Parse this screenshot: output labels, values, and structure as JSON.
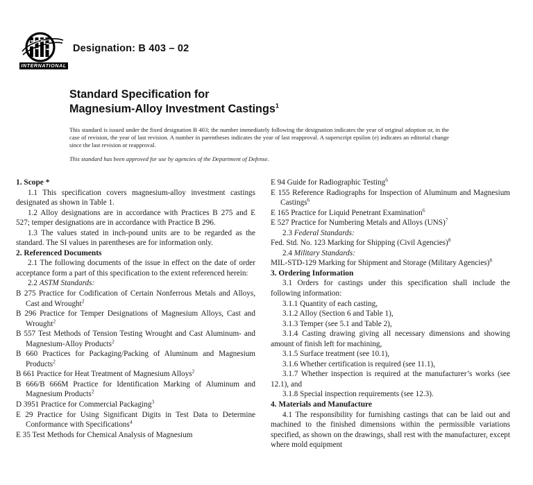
{
  "header": {
    "logo_name": "ASTM",
    "logo_subtitle": "INTERNATIONAL",
    "designation": "Designation: B 403 – 02"
  },
  "title": {
    "line1": "Standard Specification for",
    "line2": "Magnesium-Alloy Investment Castings",
    "footnote_marker": "1"
  },
  "disclaimer": {
    "text": "This standard is issued under the fixed designation B 403; the number immediately following the designation indicates the year of original adoption or, in the case of revision, the year of last revision. A number in parentheses indicates the year of last reapproval. A superscript epsilon (e) indicates an editorial change since the last revision or reapproval.",
    "dod_note": "This standard has been approved for use by agencies of the Department of Defense."
  },
  "left_column": {
    "section1_heading": "1. Scope *",
    "p_1_1": "1.1 This specification covers magnesium-alloy investment castings designated as shown in Table 1.",
    "p_1_2": "1.2 Alloy designations are in accordance with Practices B 275 and E 527; temper designations are in accordance with Practice B 296.",
    "p_1_3": "1.3 The values stated in inch-pound units are to be regarded as the standard. The SI values in parentheses are for information only.",
    "section2_heading": "2. Referenced Documents",
    "p_2_1": "2.1 The following documents of the issue in effect on the date of order acceptance form a part of this specification to the extent referenced herein:",
    "sub_2_2_num": "2.2 ",
    "sub_2_2": "ASTM Standards:",
    "refs": [
      {
        "text": "B 275  Practice for Codification of Certain Nonferrous Metals and Alloys, Cast and Wrought",
        "sup": "2"
      },
      {
        "text": "B 296  Practice for Temper Designations of Magnesium Alloys, Cast and Wrought",
        "sup": "2"
      },
      {
        "text": "B 557  Test Methods of Tension Testing Wrought and Cast Aluminum- and Magnesium-Alloy Products",
        "sup": "2"
      },
      {
        "text": "B 660  Practices for Packaging/Packing of Aluminum and Magnesium Products",
        "sup": "2"
      },
      {
        "text": "B 661  Practice for Heat Treatment of Magnesium Alloys",
        "sup": "2"
      },
      {
        "text": "B 666/B 666M  Practice for Identification Marking of Aluminum and Magnesium Products",
        "sup": "2"
      },
      {
        "text": "D 3951  Practice for Commercial Packaging",
        "sup": "3"
      },
      {
        "text": "E 29  Practice for Using Significant Digits in Test Data to Determine Conformance with Specifications",
        "sup": "4"
      },
      {
        "text": "E 35  Test Methods for Chemical Analysis of Magnesium",
        "sup": ""
      }
    ]
  },
  "right_column": {
    "refs": [
      {
        "text": "E 94  Guide for Radiographic Testing",
        "sup": "6"
      },
      {
        "text": "E 155  Reference Radiographs for Inspection of Aluminum and Magnesium Castings",
        "sup": "6"
      },
      {
        "text": "E 165  Practice for Liquid Penetrant Examination",
        "sup": "6"
      },
      {
        "text": "E 527  Practice for Numbering Metals and Alloys (UNS)",
        "sup": "7"
      }
    ],
    "sub_2_3_num": "2.3 ",
    "sub_2_3": "Federal Standards:",
    "ref_fed": {
      "text": "Fed. Std. No. 123  Marking for Shipping (Civil Agencies)",
      "sup": "8"
    },
    "sub_2_4_num": "2.4 ",
    "sub_2_4": "Military Standards:",
    "ref_mil": {
      "text": "MIL-STD-129  Marking for Shipment and Storage (Military Agencies)",
      "sup": "8"
    },
    "section3_heading": "3. Ordering Information",
    "p_3_1": "3.1 Orders for castings under this specification shall include the following information:",
    "p_3_1_1": "3.1.1 Quantity of each casting,",
    "p_3_1_2": "3.1.2 Alloy (Section 6 and Table 1),",
    "p_3_1_3": "3.1.3 Temper (see 5.1 and Table 2),",
    "p_3_1_4": "3.1.4 Casting drawing giving all necessary dimensions and showing amount of finish left for machining,",
    "p_3_1_5": "3.1.5 Surface treatment (see 10.1),",
    "p_3_1_6": "3.1.6 Whether certification is required (see 11.1),",
    "p_3_1_7": "3.1.7 Whether inspection is required at the manufacturer’s works (see 12.1), and",
    "p_3_1_8": "3.1.8 Special inspection requirements (see 12.3).",
    "section4_heading": "4. Materials and Manufacture",
    "p_4_1": "4.1 The responsibility for furnishing castings that can be laid out and machined to the finished dimensions within the permissible variations specified, as shown on the drawings, shall rest with the manufacturer, except where mold equipment"
  }
}
